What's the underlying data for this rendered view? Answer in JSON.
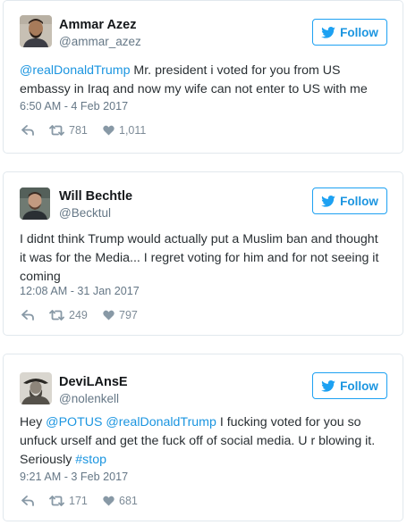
{
  "follow_label": "Follow",
  "tweets": [
    {
      "name": "Ammar Azez",
      "handle": "@ammar_azez",
      "text": [
        {
          "t": "@realDonaldTrump",
          "link": true
        },
        {
          "t": " Mr. president i voted for you from US embassy in Iraq and now my wife can not enter to US with me",
          "link": false
        }
      ],
      "time": "6:50 AM - 4 Feb 2017",
      "retweets": "781",
      "likes": "1,011"
    },
    {
      "name": "Will Bechtle",
      "handle": "@Becktul",
      "text": [
        {
          "t": "I didnt think Trump would actually put a Muslim ban and thought it was for the Media... I regret voting for him and for not seeing it coming",
          "link": false
        }
      ],
      "time": "12:08 AM - 31 Jan 2017",
      "retweets": "249",
      "likes": "797"
    },
    {
      "name": "DeviLAnsE",
      "handle": "@nolenkell",
      "text": [
        {
          "t": "Hey ",
          "link": false
        },
        {
          "t": "@POTUS",
          "link": true
        },
        {
          "t": " ",
          "link": false
        },
        {
          "t": "@realDonaldTrump",
          "link": true
        },
        {
          "t": " I fucking voted for you so unfuck urself and get the fuck off of social media. U r blowing it. Seriously ",
          "link": false
        },
        {
          "t": "#stop",
          "link": true
        }
      ],
      "time": "9:21 AM - 3 Feb 2017",
      "retweets": "171",
      "likes": "681"
    }
  ],
  "colors": {
    "link": "#1b95e0",
    "border": "#e1e8ed",
    "muted": "#657786"
  },
  "icons": [
    "twitter-bird-icon",
    "reply-icon",
    "retweet-icon",
    "heart-icon"
  ]
}
